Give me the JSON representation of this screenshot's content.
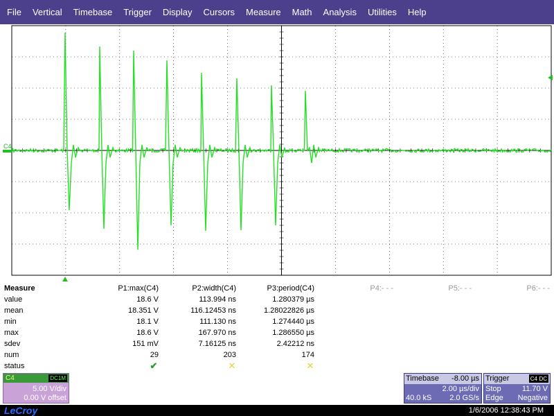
{
  "menu": [
    "File",
    "Vertical",
    "Timebase",
    "Trigger",
    "Display",
    "Cursors",
    "Measure",
    "Math",
    "Analysis",
    "Utilities",
    "Help"
  ],
  "scope": {
    "channel_marker": "C4",
    "trace_color": "#22e022",
    "grid_color": "#000000"
  },
  "measure": {
    "title": "Measure",
    "headers": [
      "P1:max(C4)",
      "P2:width(C4)",
      "P3:period(C4)",
      "P4:- - -",
      "P5:- - -",
      "P6:- - -"
    ],
    "rows": [
      {
        "label": "value",
        "p1": "18.6 V",
        "p2": "113.994 ns",
        "p3": "1.280379 µs"
      },
      {
        "label": "mean",
        "p1": "18.351 V",
        "p2": "116.12453 ns",
        "p3": "1.28022826 µs"
      },
      {
        "label": "min",
        "p1": "18.1 V",
        "p2": "111.130 ns",
        "p3": "1.274440 µs"
      },
      {
        "label": "max",
        "p1": "18.6 V",
        "p2": "167.970 ns",
        "p3": "1.286550 µs"
      },
      {
        "label": "sdev",
        "p1": "151 mV",
        "p2": "7.16125 ns",
        "p3": "2.42212 ns"
      },
      {
        "label": "num",
        "p1": "29",
        "p2": "203",
        "p3": "174"
      }
    ],
    "status_label": "status",
    "status": [
      "ok",
      "warn",
      "warn"
    ]
  },
  "channel": {
    "name": "C4",
    "coupling": "DC1M",
    "vdiv": "5.00 V/div",
    "offset": "0.00 V offset"
  },
  "timebase": {
    "title": "Timebase",
    "delay": "-8.00 µs",
    "tdiv": "2.00 µs/div",
    "samples": "40.0 kS",
    "rate": "2.0 GS/s"
  },
  "trigger": {
    "title": "Trigger",
    "source_badge": "C4",
    "coupling_badge": "DC",
    "mode": "Stop",
    "level": "11.70 V",
    "type": "Edge",
    "slope": "Negative"
  },
  "footer": {
    "brand": "LeCroy",
    "datetime": "1/6/2006 12:38:43 PM"
  }
}
